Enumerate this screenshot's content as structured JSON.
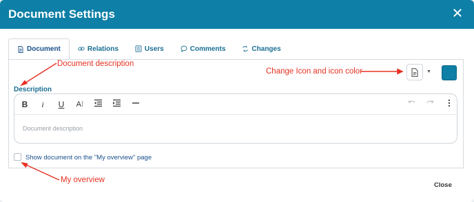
{
  "dialog": {
    "title": "Document Settings",
    "close_icon": "close-icon",
    "header_color": "#0e7fa6"
  },
  "tabs": [
    {
      "label": "Document",
      "icon": "document-icon",
      "active": true
    },
    {
      "label": "Relations",
      "icon": "link-icon",
      "active": false
    },
    {
      "label": "Users",
      "icon": "users-list-icon",
      "active": false
    },
    {
      "label": "Comments",
      "icon": "comment-icon",
      "active": false
    },
    {
      "label": "Changes",
      "icon": "changes-icon",
      "active": false
    }
  ],
  "annotations": {
    "document_description": "Document description",
    "change_icon": "Change Icon and icon color",
    "my_overview": "My overview",
    "color": "#e53122"
  },
  "icon_picker": {
    "icon": "document-icon",
    "selected_color": "#0e7fa6"
  },
  "description": {
    "label": "Description",
    "placeholder": "Document description",
    "toolbar": [
      "bold-icon",
      "italic-icon",
      "underline-icon",
      "font-size-icon",
      "indent-decrease-icon",
      "indent-increase-icon",
      "horizontal-rule-icon",
      "undo-icon",
      "redo-icon",
      "more-icon"
    ]
  },
  "overview_checkbox": {
    "label": "Show document on the \"My overview\" page",
    "checked": false
  },
  "footer": {
    "close_label": "Close"
  }
}
